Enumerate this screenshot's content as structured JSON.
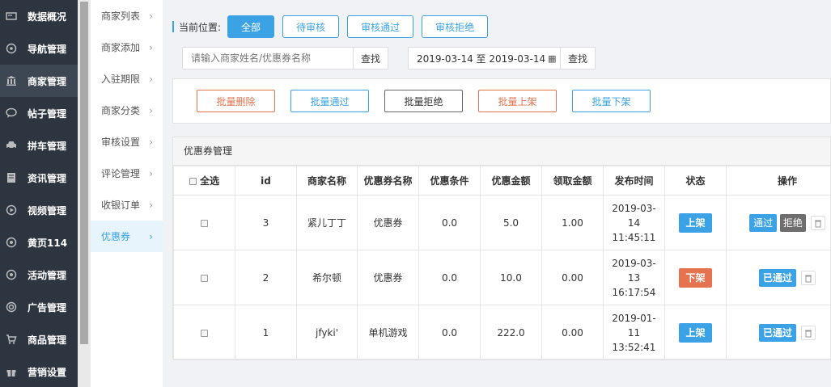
{
  "sidebar": {
    "items": [
      {
        "label": "数据概况",
        "icon": "dashboard-icon"
      },
      {
        "label": "导航管理",
        "icon": "compass-icon"
      },
      {
        "label": "商家管理",
        "icon": "bank-icon"
      },
      {
        "label": "帖子管理",
        "icon": "comment-icon"
      },
      {
        "label": "拼车管理",
        "icon": "car-icon"
      },
      {
        "label": "资讯管理",
        "icon": "news-icon"
      },
      {
        "label": "视频管理",
        "icon": "video-icon"
      },
      {
        "label": "黄页114",
        "icon": "phone-book-icon"
      },
      {
        "label": "活动管理",
        "icon": "activity-icon"
      },
      {
        "label": "广告管理",
        "icon": "lifebuoy-icon"
      },
      {
        "label": "商品管理",
        "icon": "cart-icon"
      },
      {
        "label": "营销设置",
        "icon": "gift-icon"
      }
    ]
  },
  "submenu": {
    "items": [
      {
        "label": "商家列表"
      },
      {
        "label": "商家添加"
      },
      {
        "label": "入驻期限"
      },
      {
        "label": "商家分类"
      },
      {
        "label": "审核设置"
      },
      {
        "label": "评论管理"
      },
      {
        "label": "收银订单"
      },
      {
        "label": "优惠券"
      }
    ]
  },
  "breadcrumb": {
    "label": "当前位置:",
    "tabs": [
      {
        "label": "全部"
      },
      {
        "label": "待审核"
      },
      {
        "label": "审核通过"
      },
      {
        "label": "审核拒绝"
      }
    ]
  },
  "search": {
    "placeholder": "请输入商家姓名/优惠券名称",
    "find_label": "查找",
    "date_range": "2019-03-14 至 2019-03-14",
    "date_find_label": "查找"
  },
  "batch": {
    "delete": "批量删除",
    "pass": "批量通过",
    "reject": "批量拒绝",
    "shelf_up": "批量上架",
    "shelf_down": "批量下架"
  },
  "table": {
    "title": "优惠券管理",
    "headers": {
      "select_all": "全选",
      "id": "id",
      "merchant": "商家名称",
      "coupon": "优惠券名称",
      "condition": "优惠条件",
      "amount": "优惠金额",
      "claim": "领取金额",
      "time": "发布时间",
      "status": "状态",
      "ops": "操作"
    },
    "rows": [
      {
        "id": "3",
        "merchant": "紧儿丁丁",
        "coupon": "优惠券",
        "condition": "0.0",
        "amount": "5.0",
        "claim": "1.00",
        "date": "2019-03-",
        "date2": "14",
        "time": "11:45:11",
        "status": "上架",
        "op1": "通过",
        "op2": "拒绝"
      },
      {
        "id": "2",
        "merchant": "希尔顿",
        "coupon": "优惠券",
        "condition": "0.0",
        "amount": "10.0",
        "claim": "0.00",
        "date": "2019-03-",
        "date2": "13",
        "time": "16:17:54",
        "status": "下架",
        "op1": "已通过"
      },
      {
        "id": "1",
        "merchant": "jfyki'",
        "coupon": "单机游戏",
        "condition": "0.0",
        "amount": "222.0",
        "claim": "0.00",
        "date": "2019-01-",
        "date2": "11",
        "time": "13:52:41",
        "status": "上架",
        "op1": "已通过"
      }
    ]
  },
  "colors": {
    "primary": "#3ba3e5",
    "danger": "#e5734f",
    "sidebar_bg": "#2d3640"
  }
}
